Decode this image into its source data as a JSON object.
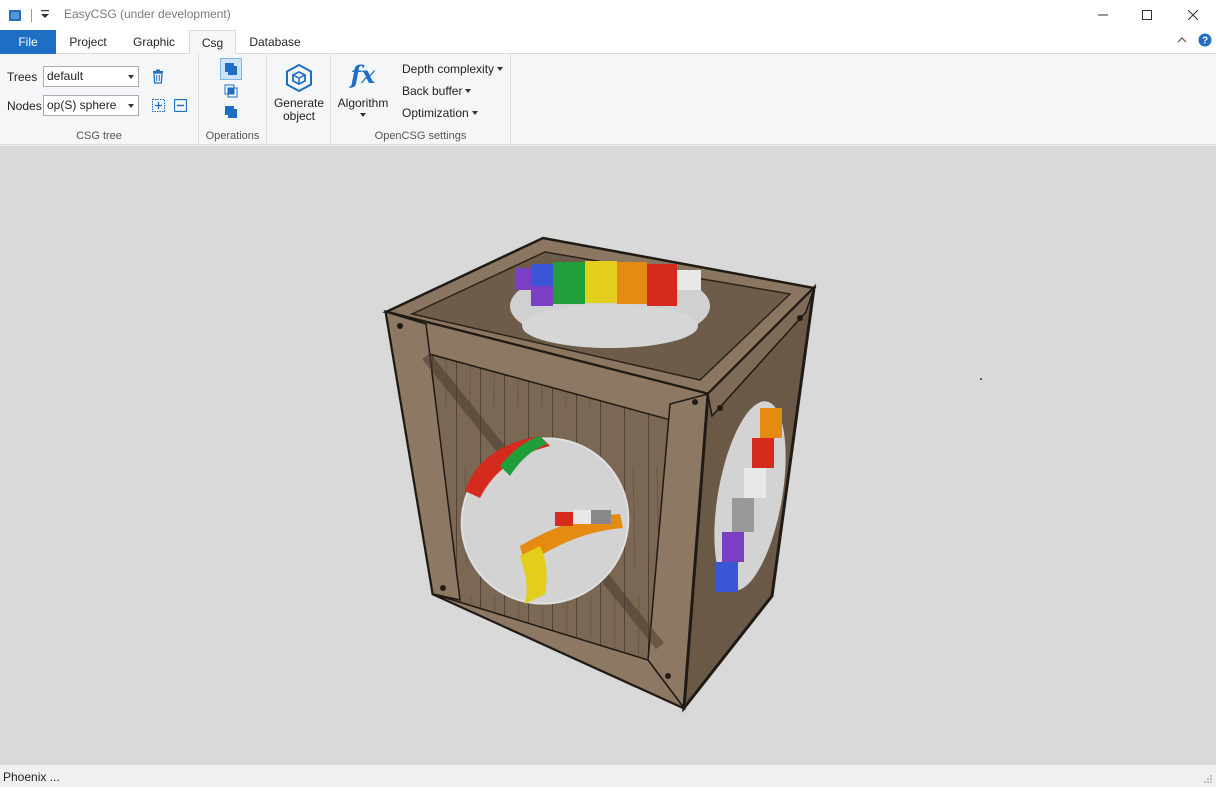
{
  "window": {
    "title": "EasyCSG (under development)"
  },
  "tabs": [
    {
      "label": "File"
    },
    {
      "label": "Project"
    },
    {
      "label": "Graphic"
    },
    {
      "label": "Csg"
    },
    {
      "label": "Database"
    }
  ],
  "ribbon": {
    "csg_tree": {
      "trees_label": "Trees",
      "trees_value": "default",
      "nodes_label": "Nodes",
      "nodes_value": "op(S) sphere",
      "group_label": "CSG tree"
    },
    "operations": {
      "group_label": "Operations"
    },
    "generate": {
      "label_line1": "Generate",
      "label_line2": "object"
    },
    "opencsg": {
      "algorithm_label": "Algorithm",
      "fx_glyph": "fx",
      "depth_complexity": "Depth complexity",
      "back_buffer": "Back buffer",
      "optimization": "Optimization",
      "group_label": "OpenCSG settings"
    }
  },
  "status": {
    "text": "Phoenix ..."
  },
  "colors": {
    "accent": "#1e6fc4",
    "viewport_bg": "#d9d9d9",
    "wood": "#7d6b58"
  },
  "icons": [
    "app-icon",
    "quick-access-dropdown-icon",
    "minimize-icon",
    "maximize-icon",
    "close-icon",
    "collapse-ribbon-icon",
    "help-icon",
    "delete-tree-icon",
    "add-node-icon",
    "remove-node-icon",
    "union-icon",
    "intersection-icon",
    "subtraction-icon",
    "generate-object-icon",
    "algorithm-fx-icon",
    "resize-grip-icon"
  ]
}
